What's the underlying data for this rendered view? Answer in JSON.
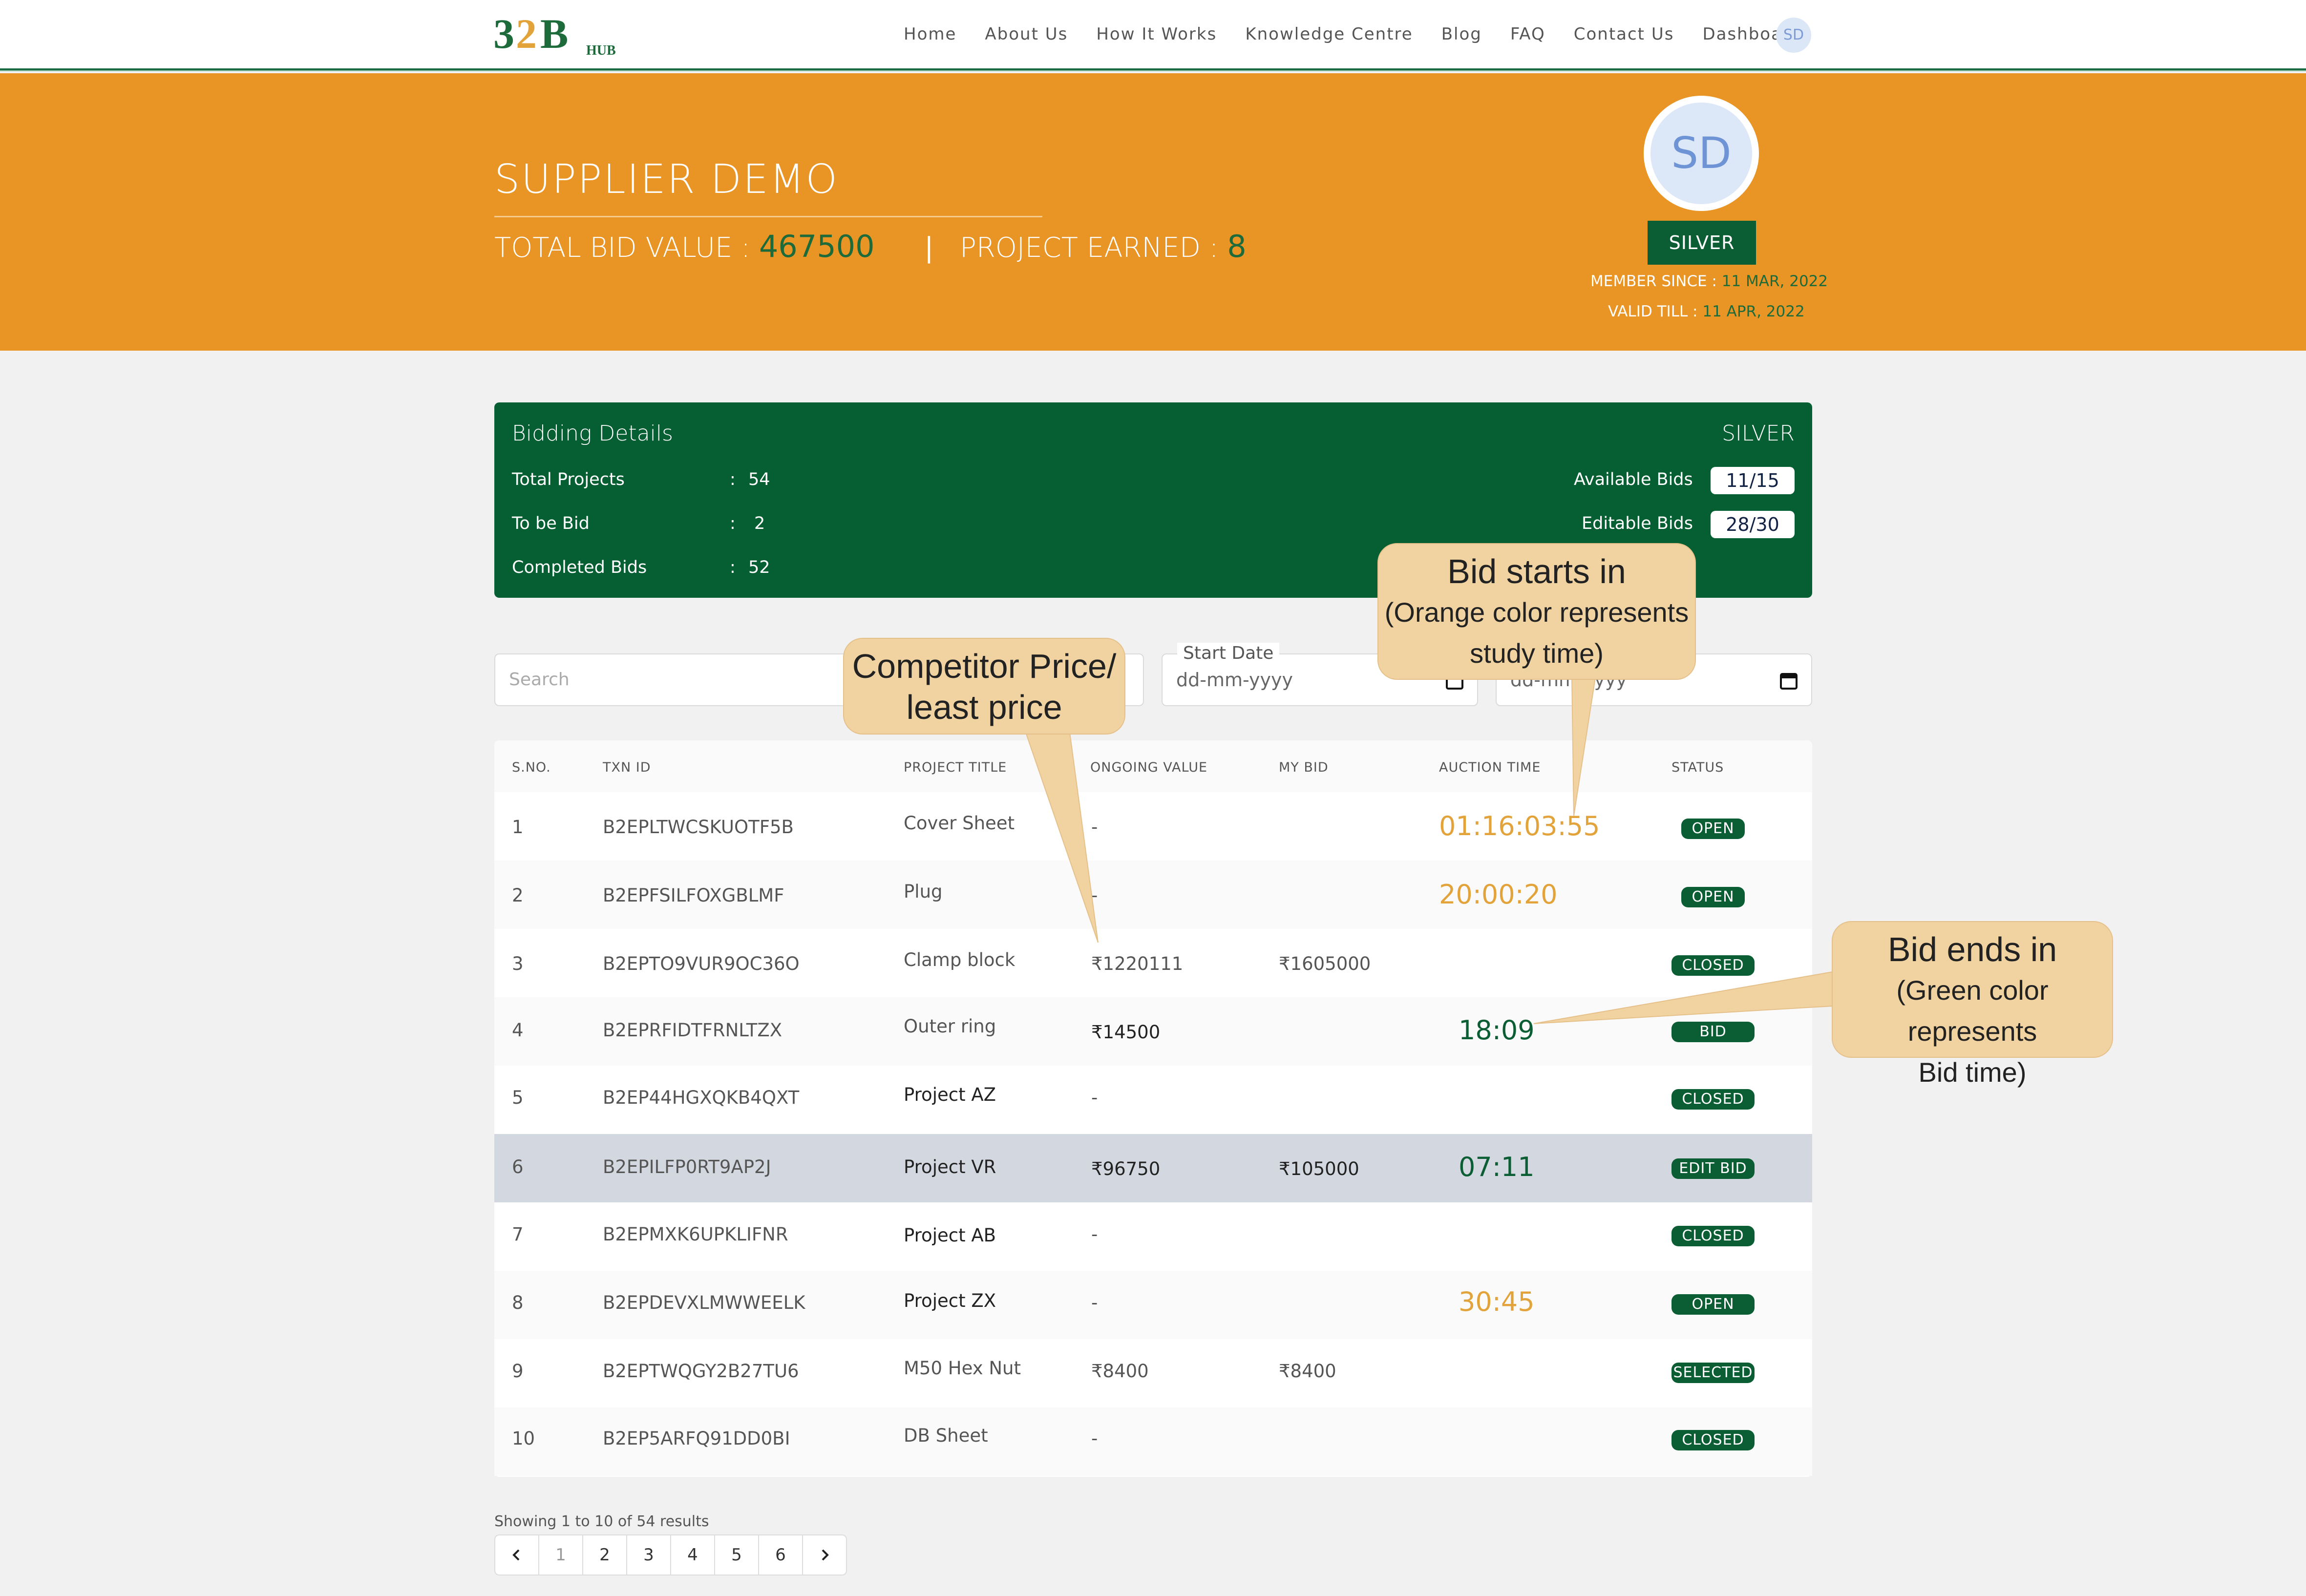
{
  "nav": {
    "logo_text": "B2B HUB",
    "items": [
      "Home",
      "About Us",
      "How It Works",
      "Knowledge Centre",
      "Blog",
      "FAQ",
      "Contact Us",
      "Dashboard"
    ],
    "avatar_initials": "SD"
  },
  "hero": {
    "name": "SUPPLIER DEMO",
    "total_bid_label": "TOTAL BID VALUE :",
    "total_bid_value": "467500",
    "separator": "|",
    "project_earned_label": "PROJECT EARNED :",
    "project_earned_value": "8",
    "avatar_initials": "SD",
    "plan_badge": "SILVER",
    "member_since_label": "MEMBER SINCE :",
    "member_since_value": "11 MAR, 2022",
    "valid_till_label": "VALID TILL :",
    "valid_till_value": "11 APR, 2022"
  },
  "bidding": {
    "title": "Bidding Details",
    "plan": "SILVER",
    "rows": [
      {
        "label": "Total Projects",
        "colon": ":",
        "value": "54"
      },
      {
        "label": "To be Bid",
        "colon": ":",
        "value": "2"
      },
      {
        "label": "Completed Bids",
        "colon": ":",
        "value": "52"
      }
    ],
    "available_label": "Available Bids",
    "available_value": "11/15",
    "editable_label": "Editable Bids",
    "editable_value": "28/30"
  },
  "filters": {
    "search_placeholder": "Search",
    "start_date_label": "Start Date",
    "start_date_placeholder": "dd-mm-yyyy",
    "end_date_placeholder": "dd-mm-yyyy"
  },
  "table": {
    "headers": [
      "S.NO.",
      "TXN ID",
      "PROJECT TITLE",
      "ONGOING VALUE",
      "MY BID",
      "AUCTION TIME",
      "STATUS"
    ],
    "rows": [
      {
        "sno": "1",
        "txn": "B2EPLTWCSKUOTF5B",
        "title": "Cover Sheet",
        "ongoing": "-",
        "mybid": "",
        "time": "01:16:03:55",
        "status": "OPEN"
      },
      {
        "sno": "2",
        "txn": "B2EPFSILFOXGBLMF",
        "title": "Plug",
        "ongoing": "-",
        "mybid": "",
        "time": "20:00:20",
        "status": "OPEN"
      },
      {
        "sno": "3",
        "txn": "B2EPTO9VUR9OC36O",
        "title": "Clamp block",
        "ongoing": "₹1220111",
        "mybid": "₹1605000",
        "time": "",
        "status": "CLOSED"
      },
      {
        "sno": "4",
        "txn": "B2EPRFIDTFRNLTZX",
        "title": "Outer ring",
        "ongoing": "₹14500",
        "mybid": "",
        "time": "18:09",
        "status": "BID"
      },
      {
        "sno": "5",
        "txn": "B2EP44HGXQKB4QXT",
        "title": "Project AZ",
        "ongoing": "-",
        "mybid": "",
        "time": "",
        "status": "CLOSED"
      },
      {
        "sno": "6",
        "txn": "B2EPILFP0RT9AP2J",
        "title": "Project VR",
        "ongoing": "₹96750",
        "mybid": "₹105000",
        "time": "07:11",
        "status": "EDIT BID"
      },
      {
        "sno": "7",
        "txn": "B2EPMXK6UPKLIFNR",
        "title": "Project AB",
        "ongoing": "-",
        "mybid": "",
        "time": "",
        "status": "CLOSED"
      },
      {
        "sno": "8",
        "txn": "B2EPDEVXLMWWEELK",
        "title": "Project ZX",
        "ongoing": "-",
        "mybid": "",
        "time": "30:45",
        "status": "OPEN"
      },
      {
        "sno": "9",
        "txn": "B2EPTWQGY2B27TU6",
        "title": "M50 Hex Nut",
        "ongoing": "₹8400",
        "mybid": "₹8400",
        "time": "",
        "status": "SELECTED"
      },
      {
        "sno": "10",
        "txn": "B2EP5ARFQ91DD0BI",
        "title": "DB Sheet",
        "ongoing": "-",
        "mybid": "",
        "time": "",
        "status": "CLOSED"
      }
    ]
  },
  "pagination": {
    "results_text": "Showing 1 to 10 of 54 results",
    "pages": [
      "1",
      "2",
      "3",
      "4",
      "5",
      "6"
    ],
    "active_page": "1"
  },
  "callouts": {
    "competitor": {
      "line1": "Competitor Price/",
      "line2": "least price"
    },
    "bid_starts": {
      "line1": "Bid starts in",
      "line2": "(Orange color represents",
      "line3": "study time)"
    },
    "bid_ends": {
      "line1": "Bid ends in",
      "line2": "(Green color represents",
      "line3": "Bid time)"
    }
  },
  "colors": {
    "brand_green": "#0b5e33",
    "hero_orange": "#e99526",
    "study_time_orange": "#e3a33b",
    "callout_fill": "#f0d3a0"
  }
}
